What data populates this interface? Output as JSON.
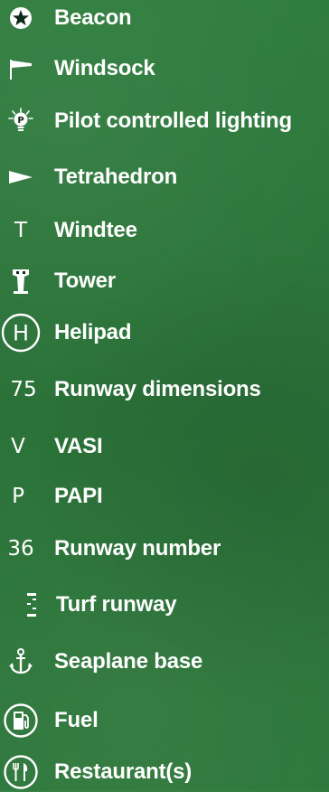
{
  "legend": {
    "items": [
      {
        "icon": "star-beacon-icon",
        "label": "Beacon"
      },
      {
        "icon": "windsock-icon",
        "label": "Windsock"
      },
      {
        "icon": "pilot-controlled-lighting-icon",
        "label": "Pilot controlled lighting"
      },
      {
        "icon": "tetrahedron-icon",
        "label": "Tetrahedron"
      },
      {
        "icon": "windtee-icon",
        "icon_text": "T",
        "label": "Windtee"
      },
      {
        "icon": "tower-icon",
        "label": "Tower"
      },
      {
        "icon": "helipad-icon",
        "icon_text": "H",
        "label": "Helipad"
      },
      {
        "icon": "runway-dimensions-icon",
        "icon_text": "75",
        "label": "Runway dimensions"
      },
      {
        "icon": "vasi-icon",
        "icon_text": "V",
        "label": "VASI"
      },
      {
        "icon": "papi-icon",
        "icon_text": "P",
        "label": "PAPI"
      },
      {
        "icon": "runway-number-icon",
        "icon_text": "36",
        "label": "Runway number"
      },
      {
        "icon": "turf-runway-icon",
        "label": "Turf runway"
      },
      {
        "icon": "anchor-icon",
        "label": "Seaplane base"
      },
      {
        "icon": "fuel-pump-icon",
        "label": "Fuel"
      },
      {
        "icon": "fork-knife-icon",
        "label": "Restaurant(s)"
      }
    ]
  },
  "colors": {
    "background": "#2e7a3c",
    "text": "#ffffff"
  }
}
